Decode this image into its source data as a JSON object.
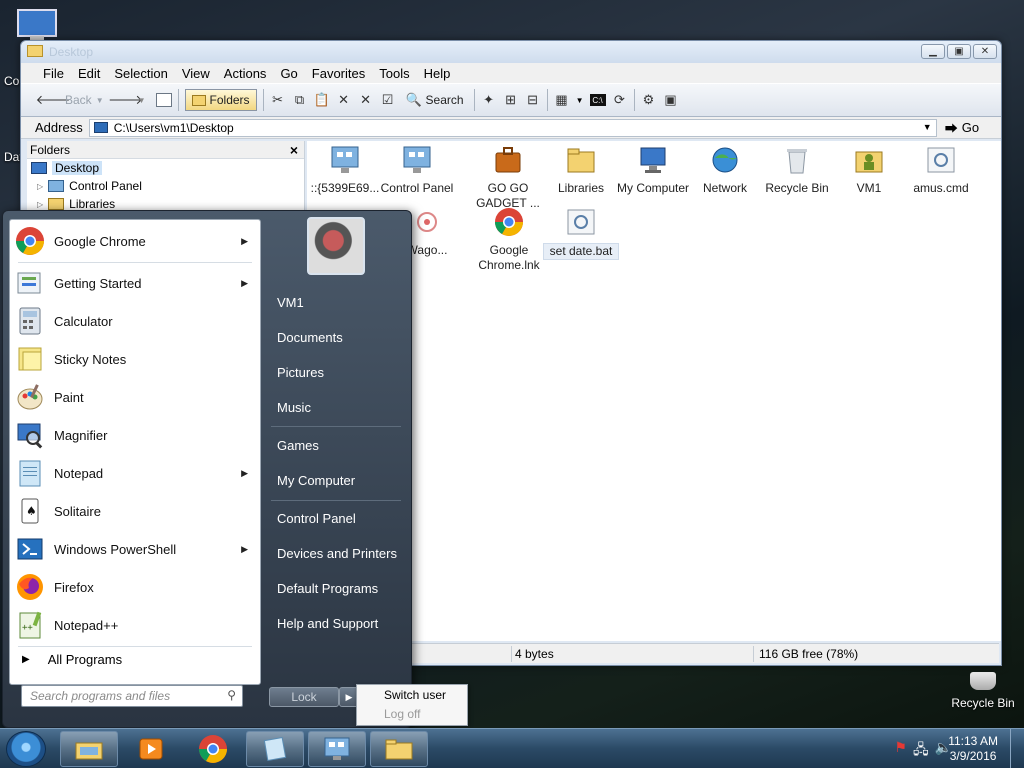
{
  "desktop": {
    "left_labels": [
      "Co",
      "Dat"
    ],
    "recycle_bin": "Recycle Bin"
  },
  "window": {
    "title": "Desktop",
    "menu": [
      "File",
      "Edit",
      "Selection",
      "View",
      "Actions",
      "Go",
      "Favorites",
      "Tools",
      "Help"
    ],
    "toolbar": {
      "back": "Back",
      "folders": "Folders",
      "search": "Search"
    },
    "address": {
      "label": "Address",
      "path": "C:\\Users\\vm1\\Desktop",
      "go": "Go"
    },
    "folders_pane": {
      "title": "Folders",
      "close": "×",
      "items": [
        "Desktop",
        "Control Panel",
        "Libraries"
      ]
    },
    "files": [
      {
        "label": "::{5399E69...",
        "icon": "network-connection-icon"
      },
      {
        "label": "Control Panel",
        "icon": "control-panel-icon"
      },
      {
        "label": "GO GO GADGET ...",
        "icon": "briefcase-icon"
      },
      {
        "label": "Libraries",
        "icon": "libraries-icon"
      },
      {
        "label": "My Computer",
        "icon": "computer-icon"
      },
      {
        "label": "Network",
        "icon": "network-icon"
      },
      {
        "label": "Recycle Bin",
        "icon": "recycle-bin-icon"
      },
      {
        "label": "VM1",
        "icon": "user-folder-icon"
      },
      {
        "label": "amus.cmd",
        "icon": "cmd-file-icon"
      },
      {
        "label": "Wago...",
        "icon": "wago-icon"
      },
      {
        "label": "Google Chrome.lnk",
        "icon": "chrome-shortcut-icon"
      },
      {
        "label": "set date.bat",
        "icon": "bat-file-icon"
      }
    ],
    "status": {
      "size": "4 bytes",
      "free": "116 GB free (78%)"
    }
  },
  "start_menu": {
    "programs": [
      {
        "label": "Google Chrome",
        "icon": "chrome-icon",
        "submenu": true
      },
      {
        "label": "Getting Started",
        "icon": "getting-started-icon",
        "submenu": true
      },
      {
        "label": "Calculator",
        "icon": "calculator-icon",
        "submenu": false
      },
      {
        "label": "Sticky Notes",
        "icon": "sticky-notes-icon",
        "submenu": false
      },
      {
        "label": "Paint",
        "icon": "paint-icon",
        "submenu": false
      },
      {
        "label": "Magnifier",
        "icon": "magnifier-icon",
        "submenu": false
      },
      {
        "label": "Notepad",
        "icon": "notepad-icon",
        "submenu": true
      },
      {
        "label": "Solitaire",
        "icon": "solitaire-icon",
        "submenu": false
      },
      {
        "label": "Windows PowerShell",
        "icon": "powershell-icon",
        "submenu": true
      },
      {
        "label": "Firefox",
        "icon": "firefox-icon",
        "submenu": false
      },
      {
        "label": "Notepad++",
        "icon": "notepadpp-icon",
        "submenu": false
      }
    ],
    "all_programs": "All Programs",
    "search_placeholder": "Search programs and files",
    "right_items": [
      "VM1",
      "Documents",
      "Pictures",
      "Music",
      "Games",
      "My Computer",
      "Control Panel",
      "Devices and Printers",
      "Default Programs",
      "Help and Support"
    ],
    "lock": "Lock",
    "power_submenu": [
      "Switch user",
      "Log off"
    ]
  },
  "taskbar": {
    "time": "11:13 AM",
    "date": "3/9/2016"
  }
}
